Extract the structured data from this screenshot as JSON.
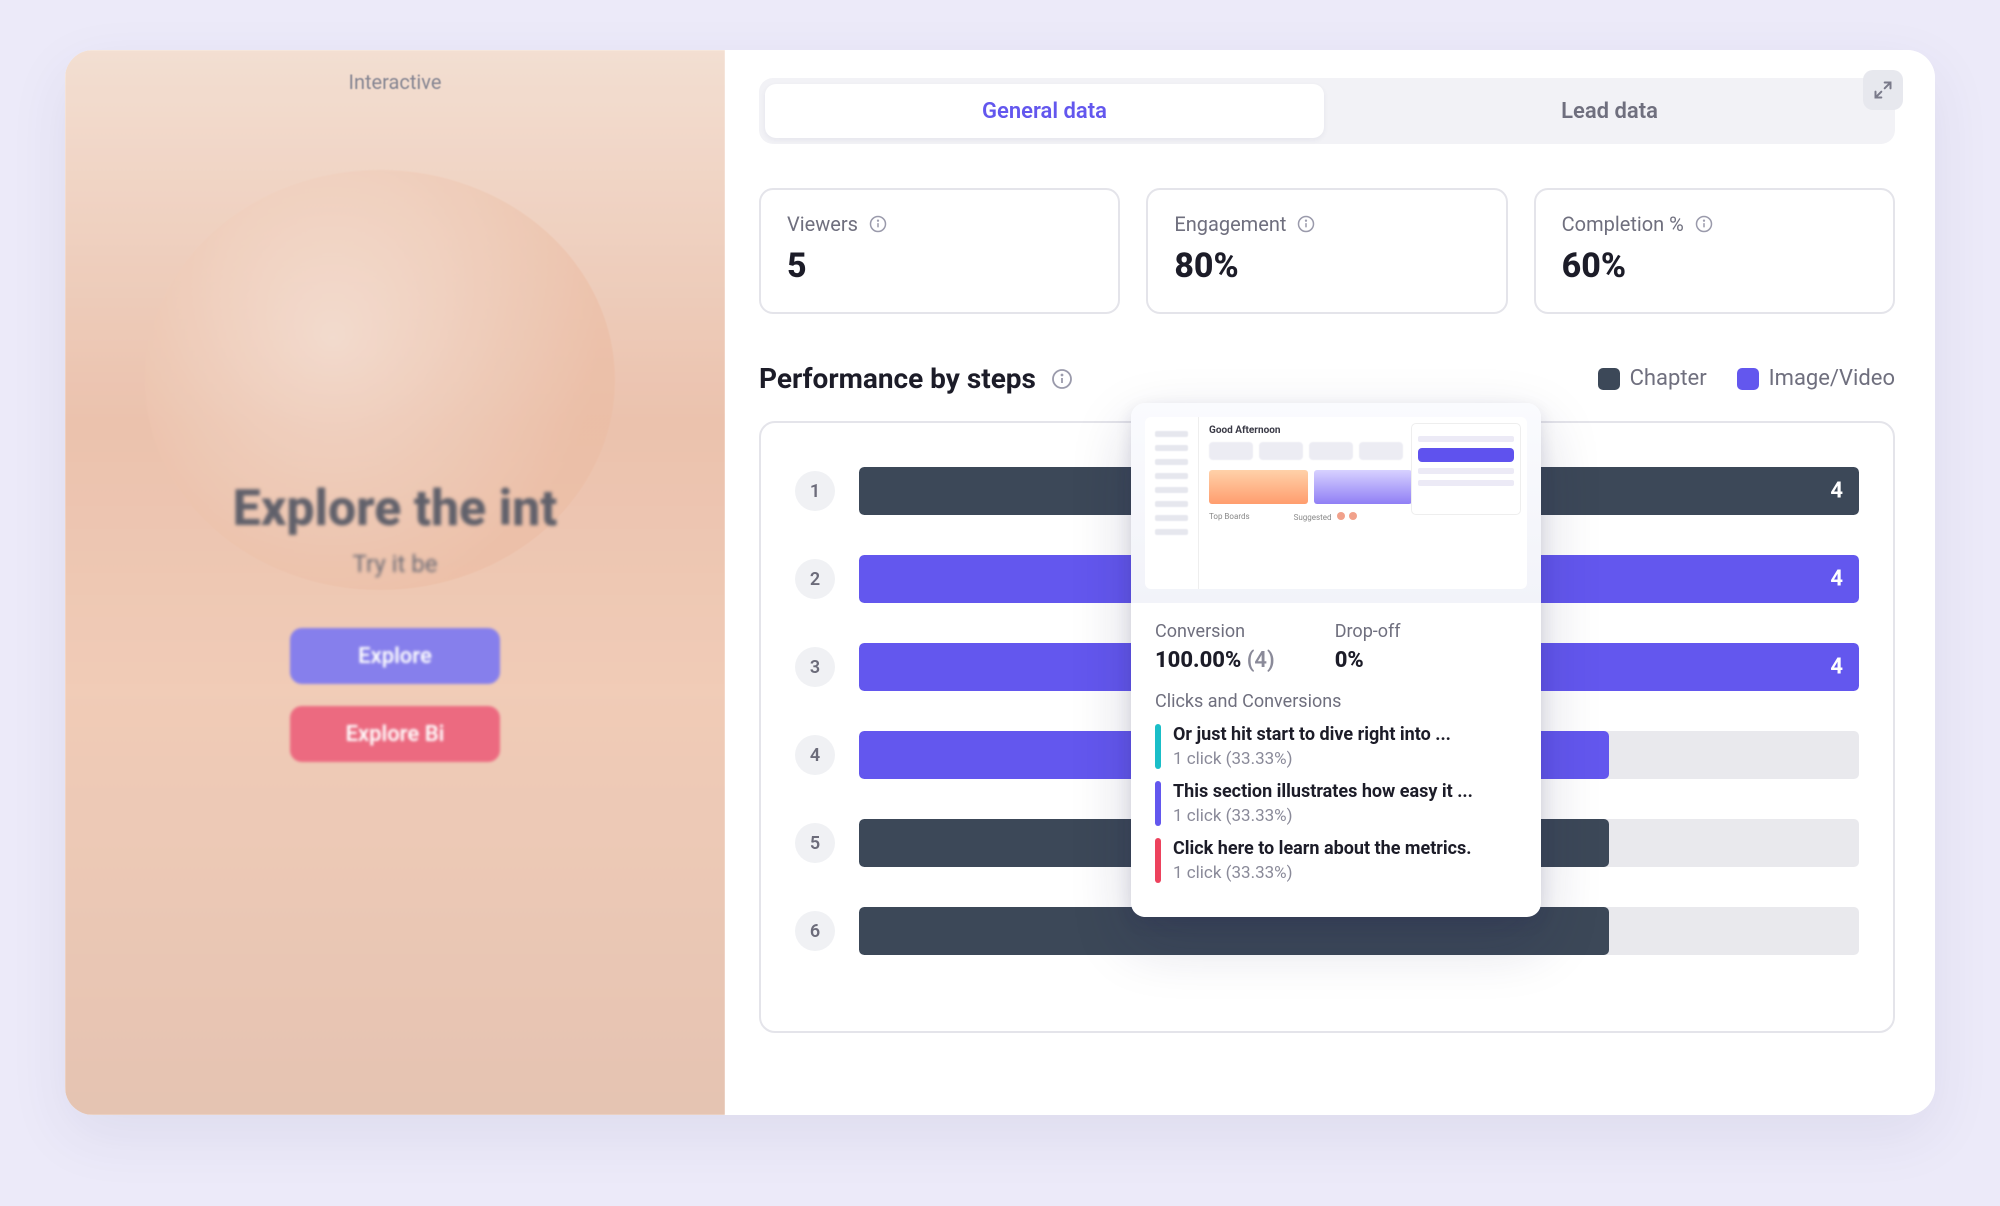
{
  "preview": {
    "top_tag": "Interactive",
    "headline": "Explore the int",
    "sub": "Try it be",
    "btn1": "Explore",
    "btn2": "Explore Bi"
  },
  "tabs": {
    "general": "General data",
    "lead": "Lead data"
  },
  "metrics": {
    "viewers": {
      "label": "Viewers",
      "value": "5"
    },
    "engagement": {
      "label": "Engagement",
      "value": "80%"
    },
    "completion": {
      "label": "Completion %",
      "value": "60%"
    }
  },
  "section_title": "Performance by steps",
  "legend": {
    "chapter": "Chapter",
    "media": "Image/Video"
  },
  "tooltip": {
    "conversion_label": "Conversion",
    "conversion_value": "100.00%",
    "conversion_count": "(4)",
    "dropoff_label": "Drop-off",
    "dropoff_value": "0%",
    "section": "Clicks and Conversions",
    "items": [
      {
        "color": "#1abec8",
        "title": "Or just hit start to dive right into ...",
        "meta": "1 click (33.33%)"
      },
      {
        "color": "#6357ee",
        "title": "This section illustrates how easy it ...",
        "meta": "1 click (33.33%)"
      },
      {
        "color": "#ed425d",
        "title": "Click here to learn about the metrics.",
        "meta": "1 click (33.33%)"
      }
    ],
    "mini_title": "Good Afternoon"
  },
  "chart_data": {
    "type": "bar",
    "title": "Performance by steps",
    "xlabel": "",
    "ylabel": "",
    "ylim": [
      0,
      4
    ],
    "categories": [
      "1",
      "2",
      "3",
      "4",
      "5",
      "6"
    ],
    "series": [
      {
        "name": "value",
        "values": [
          4,
          4,
          4,
          3,
          3,
          3
        ]
      },
      {
        "name": "kind",
        "values": [
          "chapter",
          "media",
          "media",
          "media",
          "chapter",
          "chapter"
        ]
      },
      {
        "name": "pct",
        "values": [
          100,
          100,
          100,
          75,
          75,
          75
        ]
      }
    ],
    "colors": {
      "chapter": "#3c4858",
      "media": "#6357ee"
    }
  }
}
